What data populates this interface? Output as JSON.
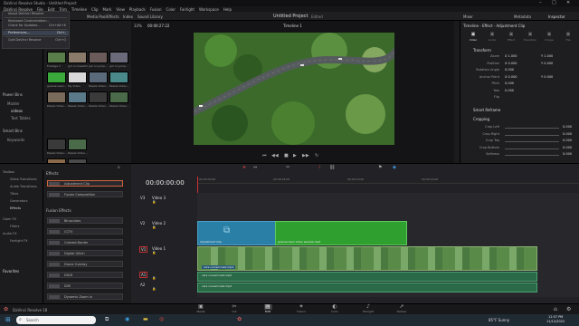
{
  "titlebar": {
    "app_title": "DaVinci Resolve Studio - Untitled Project"
  },
  "menubar": {
    "items": [
      "DaVinci Resolve",
      "File",
      "Edit",
      "Trim",
      "Timeline",
      "Clip",
      "Mark",
      "View",
      "Playback",
      "Fusion",
      "Color",
      "Fairlight",
      "Workspace",
      "Help"
    ]
  },
  "dropdown": {
    "items": [
      {
        "label": "About DaVinci Resolve",
        "shortcut": ""
      },
      {
        "label": "Keyboard Customization...",
        "shortcut": "Ctrl+Alt+K"
      },
      {
        "label": "Check for Updates...",
        "shortcut": ""
      },
      {
        "label": "Preferences...",
        "shortcut": "Ctrl+,"
      },
      {
        "label": "Quit DaVinci Resolve",
        "shortcut": "Ctrl+Q"
      }
    ]
  },
  "topbar": {
    "media_pool": "Media Pool",
    "effects": "Effects",
    "index": "Index",
    "sound_library": "Sound Library",
    "project_title": "Untitled Project",
    "edited": "Edited",
    "zoom": "33%",
    "timecode": "00:00:27:22",
    "timeline_name": "Timeline 1",
    "mixer": "Mixer",
    "metadata": "Metadata",
    "inspector": "Inspector"
  },
  "bins": {
    "power_bins": "Power Bins",
    "master": "Master",
    "videos": "videos",
    "test_tables": "Test Tables",
    "smart_bins": "Smart Bins",
    "keywords": "Keywords"
  },
  "media": [
    {
      "label": "Footage 3",
      "color": "#5a7e4a"
    },
    {
      "label": "girl on treadmill",
      "color": "#8a7a6a"
    },
    {
      "label": "girl on jump...",
      "color": "#6a5a5a"
    },
    {
      "label": "girl on jump...",
      "color": "#6a6a7a"
    },
    {
      "label": "greenscreen...",
      "color": "#3aa83a"
    },
    {
      "label": "My Video",
      "color": "#d8d8d8"
    },
    {
      "label": "Pexels Video...",
      "color": "#5a6a7a"
    },
    {
      "label": "Pexels Video...",
      "color": "#4a8a8a"
    },
    {
      "label": "Pexels Video...",
      "color": "#7a6a5a"
    },
    {
      "label": "Pexels Video...",
      "color": "#5a7a8a"
    },
    {
      "label": "Pexels Video...",
      "color": "#3a3a3a"
    },
    {
      "label": "Pexels Video...",
      "color": "#4a6a4a"
    },
    {
      "label": "Pexels Video...",
      "color": "#8a6a4a"
    },
    {
      "label": "Pexels Video...",
      "color": "#4a4a4a"
    }
  ],
  "effects_panel": {
    "tree": [
      {
        "label": "Toolbox",
        "indent": 0
      },
      {
        "label": "Video Transitions",
        "indent": 1
      },
      {
        "label": "Audio Transitions",
        "indent": 1
      },
      {
        "label": "Titles",
        "indent": 1
      },
      {
        "label": "Generators",
        "indent": 1
      },
      {
        "label": "Effects",
        "indent": 1
      },
      {
        "label": "Open FX",
        "indent": 0
      },
      {
        "label": "Filters",
        "indent": 1
      },
      {
        "label": "Audio FX",
        "indent": 0
      },
      {
        "label": "Fairlight FX",
        "indent": 1
      }
    ],
    "favorites": "Favorites",
    "effects_header": "Effects",
    "fusion_header": "Fusion Effects",
    "effects": [
      "Adjustment Clip",
      "Fusion Composition"
    ],
    "fusion_effects": [
      "Binoculars",
      "CCTV",
      "Colored Border",
      "Digital Glitch",
      "Drone Overlay",
      "DSLR",
      "DVE",
      "Dynamic Zoom In"
    ]
  },
  "inspector": {
    "title": "Timeline - Effect - Adjustment Clip",
    "tabs": [
      "Video",
      "Audio",
      "Effect",
      "Transition",
      "Image",
      "File"
    ],
    "transform": "Transform",
    "rows": [
      {
        "label": "Zoom",
        "x": "X  1.000",
        "y": "Y  1.000"
      },
      {
        "label": "Position",
        "x": "X  0.000",
        "y": "Y  0.000"
      },
      {
        "label": "Rotation Angle",
        "x": "0.000",
        "y": ""
      },
      {
        "label": "Anchor Point",
        "x": "X  0.000",
        "y": "Y  0.000"
      },
      {
        "label": "Pitch",
        "x": "0.000",
        "y": ""
      },
      {
        "label": "Yaw",
        "x": "0.000",
        "y": ""
      },
      {
        "label": "Flip",
        "x": "",
        "y": ""
      }
    ],
    "smart_reframe": "Smart Reframe",
    "cropping": "Cropping",
    "crop_rows": [
      {
        "label": "Crop Left",
        "x": "0.000"
      },
      {
        "label": "Crop Right",
        "x": "0.000"
      },
      {
        "label": "Crop Top",
        "x": "0.000"
      },
      {
        "label": "Crop Bottom",
        "x": "0.000"
      },
      {
        "label": "Softness",
        "x": "0.000"
      }
    ]
  },
  "timeline": {
    "timecode": "00:00:00:00",
    "ruler": [
      "00:00:00:00",
      "00:00:05:00",
      "00:00:10:00",
      "00:00:15:00"
    ],
    "tracks": [
      {
        "id": "V3",
        "name": "Video 3"
      },
      {
        "id": "V2",
        "name": "Video 2"
      },
      {
        "id": "V1",
        "name": "Video 1"
      },
      {
        "id": "A1",
        "name": ""
      },
      {
        "id": "A2",
        "name": ""
      }
    ],
    "clips": {
      "adjustment": "Adjustment Clip",
      "greenscreen": "greenscreen video sample.mp4",
      "v1": "cars curved road.mp4",
      "a1": "cars curved road.mp4",
      "a2": "cars curved road.mp4"
    }
  },
  "pages": [
    {
      "label": "Media",
      "icon": "▣"
    },
    {
      "label": "Cut",
      "icon": "✂"
    },
    {
      "label": "Edit",
      "icon": "▤"
    },
    {
      "label": "Fusion",
      "icon": "✶"
    },
    {
      "label": "Color",
      "icon": "◐"
    },
    {
      "label": "Fairlight",
      "icon": "♪"
    },
    {
      "label": "Deliver",
      "icon": "➚"
    }
  ],
  "pagebar": {
    "app_name": "DaVinci Resolve 18"
  },
  "taskbar": {
    "search": "Search",
    "weather": "85°F Sunny",
    "time": "12:57 PM",
    "date": "11/12/2022"
  }
}
